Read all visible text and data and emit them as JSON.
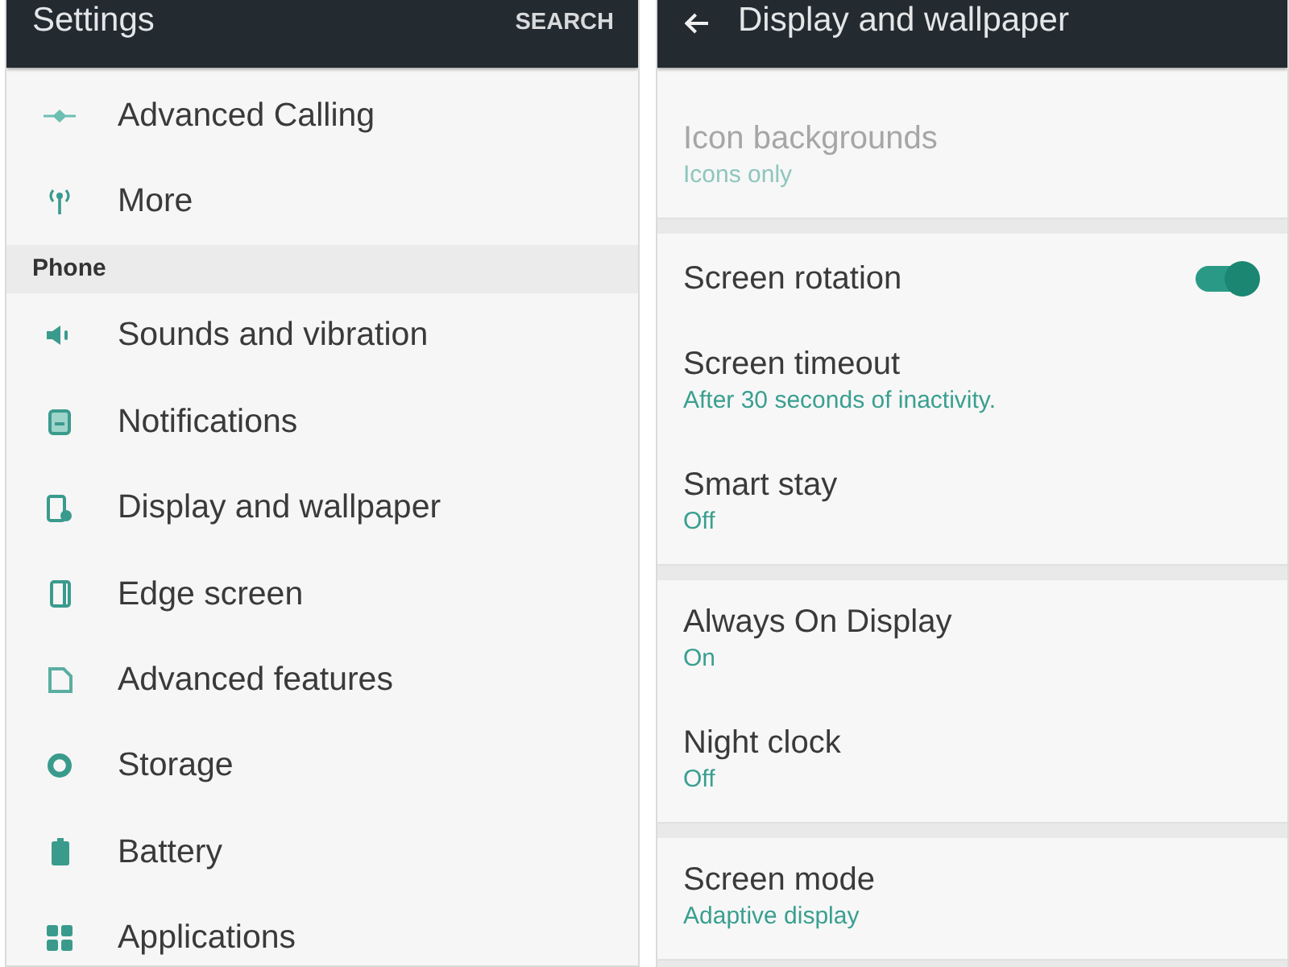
{
  "settings_screen": {
    "app_bar": {
      "title": "Settings",
      "action": "SEARCH"
    },
    "items": [
      {
        "kind": "item",
        "label": "Advanced Calling"
      },
      {
        "kind": "item",
        "label": "More"
      },
      {
        "kind": "section",
        "label": "Phone"
      },
      {
        "kind": "item",
        "label": "Sounds and vibration"
      },
      {
        "kind": "item",
        "label": "Notifications"
      },
      {
        "kind": "item",
        "label": "Display and wallpaper"
      },
      {
        "kind": "item",
        "label": "Edge screen"
      },
      {
        "kind": "item",
        "label": "Advanced features"
      },
      {
        "kind": "item",
        "label": "Storage"
      },
      {
        "kind": "item",
        "label": "Battery"
      },
      {
        "kind": "item",
        "label": "Applications"
      }
    ]
  },
  "display_screen": {
    "app_bar": {
      "title": "Display and wallpaper"
    },
    "groups": [
      {
        "items": [
          {
            "kind": "text",
            "title": "Icon backgrounds",
            "summary": "Icons only",
            "disabled": true
          }
        ]
      },
      {
        "items": [
          {
            "kind": "switch",
            "title": "Screen rotation",
            "on": true,
            "disabled": false
          },
          {
            "kind": "text",
            "title": "Screen timeout",
            "summary": "After 30 seconds of inactivity.",
            "disabled": false
          },
          {
            "kind": "text",
            "title": "Smart stay",
            "summary": "Off",
            "disabled": false
          }
        ]
      },
      {
        "items": [
          {
            "kind": "text",
            "title": "Always On Display",
            "summary": "On",
            "disabled": false
          },
          {
            "kind": "text",
            "title": "Night clock",
            "summary": "Off",
            "disabled": false
          }
        ]
      },
      {
        "items": [
          {
            "kind": "text",
            "title": "Screen mode",
            "summary": "Adaptive display",
            "disabled": false
          }
        ]
      }
    ]
  }
}
